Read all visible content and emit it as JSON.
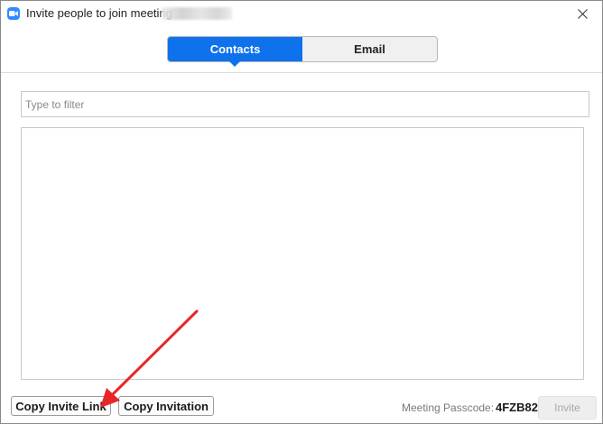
{
  "window": {
    "title": "Invite people to join meeting",
    "close_glyph": "✕"
  },
  "tabs": [
    {
      "label": "Contacts",
      "active": true
    },
    {
      "label": "Email",
      "active": false
    }
  ],
  "filter": {
    "placeholder": "Type to filter",
    "value": ""
  },
  "contacts": [],
  "footer": {
    "copy_invite_link_label": "Copy Invite Link",
    "copy_invitation_label": "Copy Invitation",
    "passcode_label": "Meeting Passcode:",
    "passcode_value": "4FZB82",
    "invite_label": "Invite"
  },
  "icons": {
    "app": "zoom-camera-icon",
    "close": "close-icon"
  },
  "colors": {
    "accent": "#0E72ED",
    "app_icon": "#2D8CFF",
    "annotation_arrow": "#E8262A",
    "disabled_text": "#A8A8A8"
  }
}
